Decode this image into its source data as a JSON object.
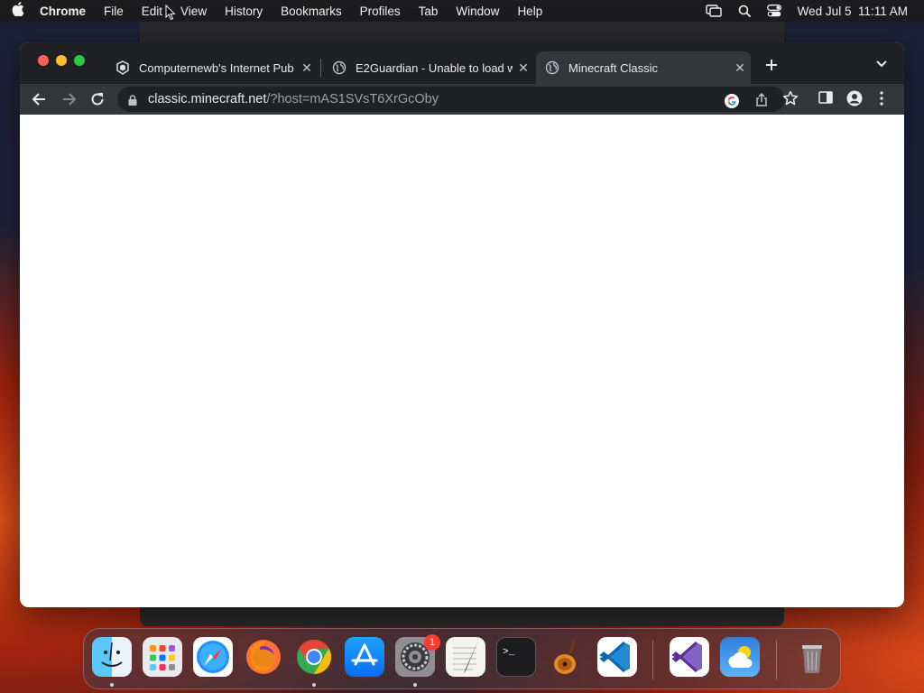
{
  "menubar": {
    "app_name": "Chrome",
    "items": [
      "File",
      "Edit",
      "View",
      "History",
      "Bookmarks",
      "Profiles",
      "Tab",
      "Window",
      "Help"
    ],
    "datetime": "Wed Jul 5  11:11 AM"
  },
  "tabs": [
    {
      "title": "Computernewb's Internet Pub",
      "icon": "computernewb-favicon-icon",
      "active": false
    },
    {
      "title": "E2Guardian - Unable to load w",
      "icon": "globe-icon",
      "active": false
    },
    {
      "title": "Minecraft Classic",
      "icon": "globe-icon",
      "active": true
    }
  ],
  "omnibox": {
    "host": "classic.minecraft.net",
    "path": "/?host=mAS1SVsT6XrGcOby"
  },
  "dock": {
    "apps": [
      "Finder",
      "Launchpad",
      "Safari",
      "Firefox",
      "Chrome",
      "App Store",
      "System Settings",
      "TextEdit",
      "Terminal",
      "GarageBand",
      "Visual Studio Code",
      "Visual Studio",
      "Weather",
      "Trash"
    ],
    "settings_badge": "1"
  },
  "colors": {
    "tabstrip": "#202124",
    "toolbar": "#35363a",
    "traffic_close": "#ff5f57",
    "traffic_min": "#febc2e",
    "traffic_max": "#28c840"
  }
}
